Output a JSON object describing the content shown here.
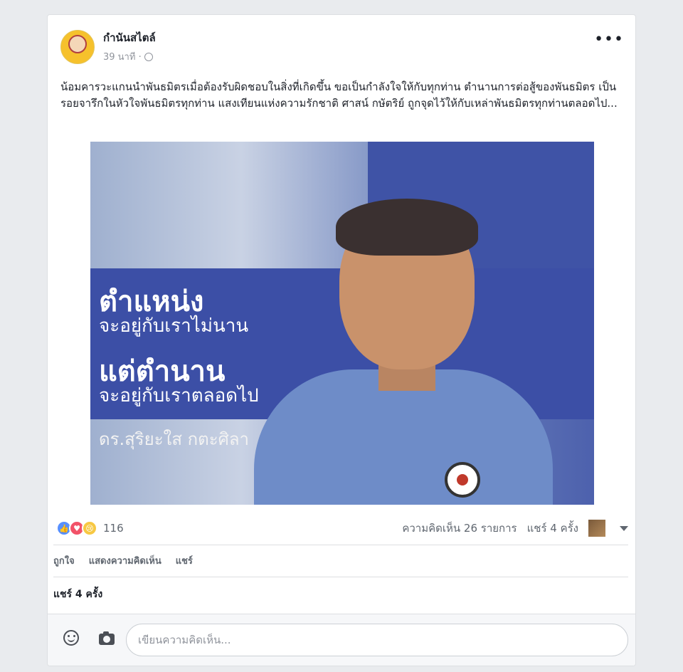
{
  "post": {
    "page_name": "กำนันสไตล์",
    "time": "39 นาที ·",
    "text": "น้อมคารวะแกนนำพันธมิตรเมื่อต้องรับผิดชอบในสิ่งที่เกิดขึ้น ขอเป็นกำลังใจให้กับทุกท่าน ตำนานการต่อสู้ของพันธมิตร เป็นรอยจารึกในหัวใจพันธมิตรทุกท่าน แสงเทียนแห่งความรักชาติ ศาสน์ กษัตริย์ ถูกจุดไว้ให้กับเหล่าพันธมิตรทุกท่านตลอดไป...",
    "more_label": "•••"
  },
  "photo": {
    "line1": "ตำแหน่ง",
    "line2": "จะอยู่กับเราไม่นาน",
    "line3": "แต่ตำนาน",
    "line4": "จะอยู่กับเราตลอดไป",
    "line5": "ดร.สุริยะใส กตะศิลา"
  },
  "stats": {
    "reaction_count": "116",
    "comments": "ความคิดเห็น 26 รายการ",
    "shares": "แชร์ 4 ครั้ง"
  },
  "actions": {
    "like": "ถูกใจ",
    "comment": "แสดงความคิดเห็น",
    "share": "แชร์"
  },
  "shares_line": "แชร์ 4 ครั้ง",
  "comment_box": {
    "placeholder": "เขียนความคิดเห็น..."
  }
}
